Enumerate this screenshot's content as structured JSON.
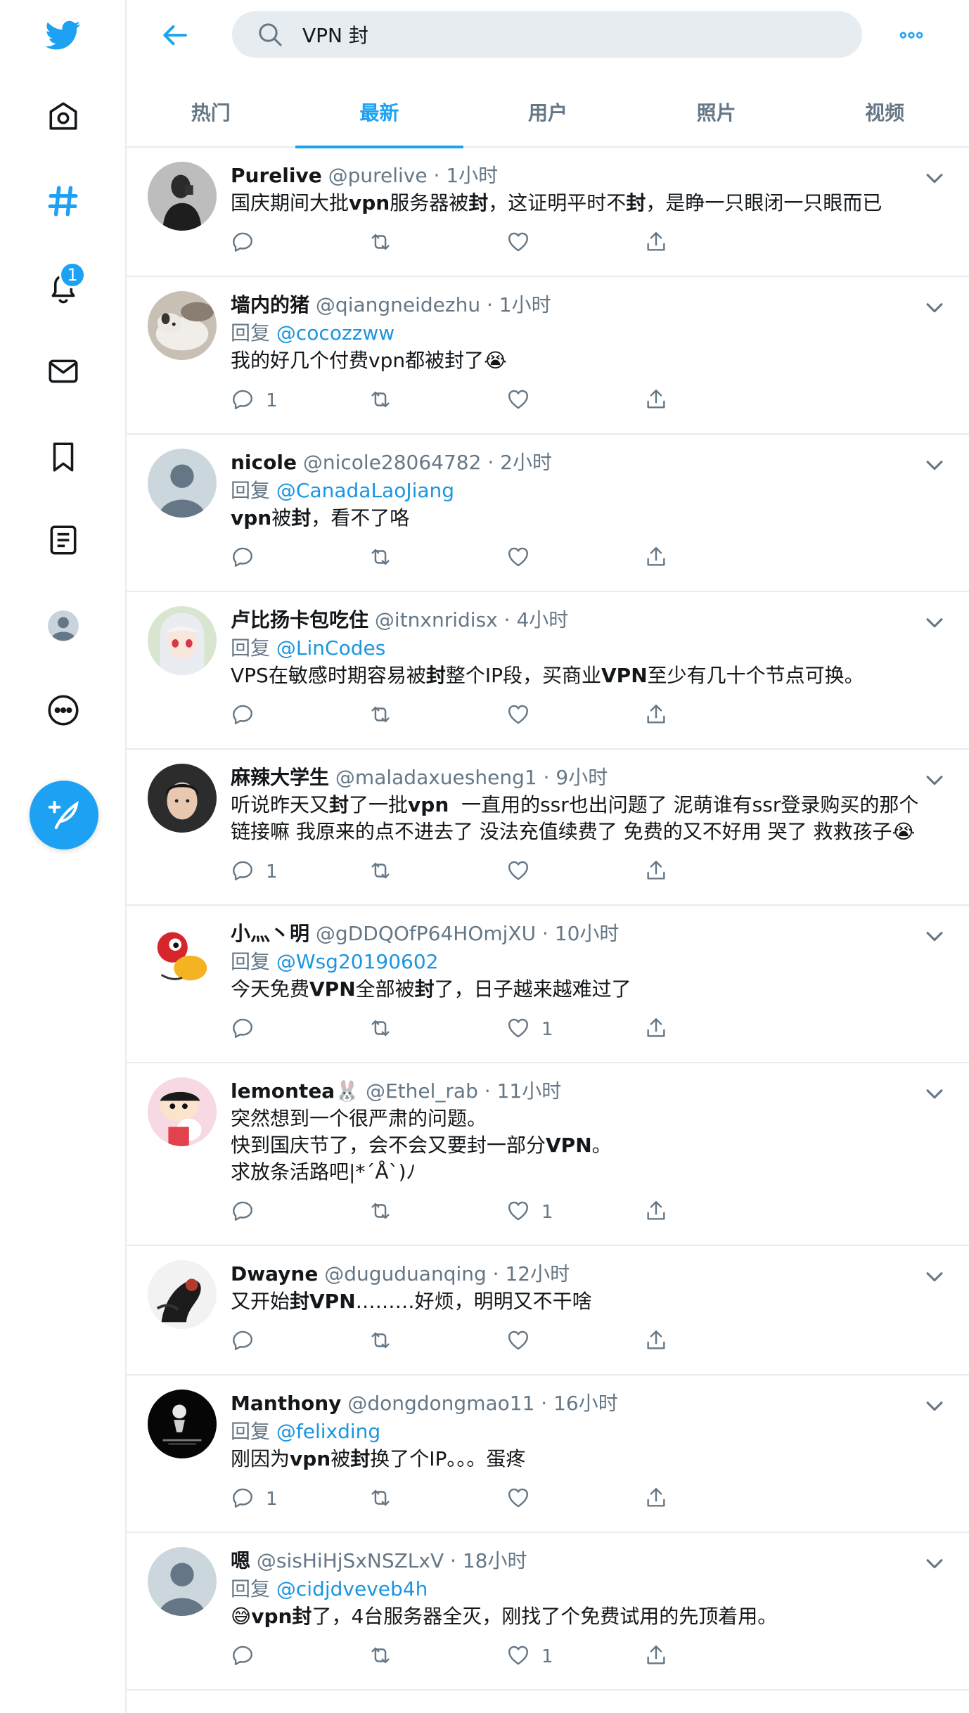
{
  "app": {
    "name": "Twitter"
  },
  "nav": {
    "notifications_badge": "1"
  },
  "search": {
    "query": "VPN 封"
  },
  "tabs": [
    {
      "label": "热门",
      "active": false
    },
    {
      "label": "最新",
      "active": true
    },
    {
      "label": "用户",
      "active": false
    },
    {
      "label": "照片",
      "active": false
    },
    {
      "label": "视频",
      "active": false
    }
  ],
  "colors": {
    "accent": "#1da1f2",
    "secondary_text": "#657786",
    "divider": "#e6ecf0"
  },
  "tweets": [
    {
      "name": "Purelive",
      "handle": "@purelive",
      "time": "1小时",
      "avatar": "bw-portrait",
      "reply_prefix": "",
      "reply_to": "",
      "text_parts": [
        [
          "t",
          "国庆期间大批"
        ],
        [
          "b",
          "vpn"
        ],
        [
          "t",
          "服务器被"
        ],
        [
          "b",
          "封"
        ],
        [
          "t",
          "，这证明平时不"
        ],
        [
          "b",
          "封"
        ],
        [
          "t",
          "，是睁一只眼闭一只眼而已"
        ]
      ],
      "replies": "",
      "likes": ""
    },
    {
      "name": "墙内的猪",
      "handle": "@qiangneidezhu",
      "time": "1小时",
      "avatar": "dog-photo",
      "reply_prefix": "回复 ",
      "reply_to": "@cocozzww",
      "text_parts": [
        [
          "t",
          "我的好几个付费vpn都被封了😭"
        ]
      ],
      "replies": "1",
      "likes": ""
    },
    {
      "name": "nicole",
      "handle": "@nicole28064782",
      "time": "2小时",
      "avatar": "default",
      "reply_prefix": "回复 ",
      "reply_to": "@CanadaLaoJiang",
      "text_parts": [
        [
          "b",
          "vpn"
        ],
        [
          "t",
          "被"
        ],
        [
          "b",
          "封"
        ],
        [
          "t",
          "，看不了咯"
        ]
      ],
      "replies": "",
      "likes": ""
    },
    {
      "name": "卢比扬卡包吃住",
      "handle": "@itnxnridisx",
      "time": "4小时",
      "avatar": "anime-girl",
      "reply_prefix": "回复 ",
      "reply_to": "@LinCodes",
      "text_parts": [
        [
          "t",
          "VPS在敏感时期容易被"
        ],
        [
          "b",
          "封"
        ],
        [
          "t",
          "整个IP段，买商业"
        ],
        [
          "b",
          "VPN"
        ],
        [
          "t",
          "至少有几十个节点可换。"
        ]
      ],
      "replies": "",
      "likes": ""
    },
    {
      "name": "麻辣大学生",
      "handle": "@maladaxuesheng1",
      "time": "9小时",
      "avatar": "young-man",
      "reply_prefix": "",
      "reply_to": "",
      "text_parts": [
        [
          "t",
          "听说昨天又"
        ],
        [
          "b",
          "封"
        ],
        [
          "t",
          "了一批"
        ],
        [
          "b",
          "vpn"
        ],
        [
          "t",
          "  一直用的ssr也出问题了 泥萌谁有ssr登录购买的那个链接嘛 我原来的点不进去了 没法充值续费了 免费的又不好用 哭了 救救孩子😭"
        ]
      ],
      "replies": "1",
      "likes": ""
    },
    {
      "name": "小灬丶明",
      "handle": "@gDDQOfP64HOmjXU",
      "time": "10小时",
      "avatar": "cartoon-red",
      "reply_prefix": "回复 ",
      "reply_to": "@Wsg20190602",
      "text_parts": [
        [
          "t",
          "今天免费"
        ],
        [
          "b",
          "VPN"
        ],
        [
          "t",
          "全部被"
        ],
        [
          "b",
          "封"
        ],
        [
          "t",
          "了，日子越来越难过了"
        ]
      ],
      "replies": "",
      "likes": "1"
    },
    {
      "name": "lemontea🐰",
      "handle": "@Ethel_rab",
      "time": "11小时",
      "avatar": "cartoon-kid",
      "reply_prefix": "",
      "reply_to": "",
      "text_parts": [
        [
          "t",
          "突然想到一个很严肃的问题。\n快到国庆节了，会不会又要封一部分"
        ],
        [
          "b",
          "VPN"
        ],
        [
          "t",
          "。\n求放条活路吧|*´Å`)ﾉ"
        ]
      ],
      "replies": "",
      "likes": "1"
    },
    {
      "name": "Dwayne",
      "handle": "@duguduanqing",
      "time": "12小时",
      "avatar": "dark-art",
      "reply_prefix": "",
      "reply_to": "",
      "text_parts": [
        [
          "t",
          "又开始"
        ],
        [
          "b",
          "封VPN"
        ],
        [
          "t",
          "………好烦，明明又不干啥"
        ]
      ],
      "replies": "",
      "likes": ""
    },
    {
      "name": "Manthony",
      "handle": "@dongdongmao11",
      "time": "16小时",
      "avatar": "black-logo",
      "reply_prefix": "回复 ",
      "reply_to": "@felixding",
      "text_parts": [
        [
          "t",
          "刚因为"
        ],
        [
          "b",
          "vpn"
        ],
        [
          "t",
          "被"
        ],
        [
          "b",
          "封"
        ],
        [
          "t",
          "换了个IP。。。蛋疼"
        ]
      ],
      "replies": "1",
      "likes": ""
    },
    {
      "name": "嗯",
      "handle": "@sisHiHjSxNSZLxV",
      "time": "18小时",
      "avatar": "default",
      "reply_prefix": "回复 ",
      "reply_to": "@cidjdveveb4h",
      "text_parts": [
        [
          "t",
          "😅"
        ],
        [
          "b",
          "vpn封"
        ],
        [
          "t",
          "了，4台服务器全灭，刚找了个免费试用的先顶着用。"
        ]
      ],
      "replies": "",
      "likes": "1"
    }
  ]
}
